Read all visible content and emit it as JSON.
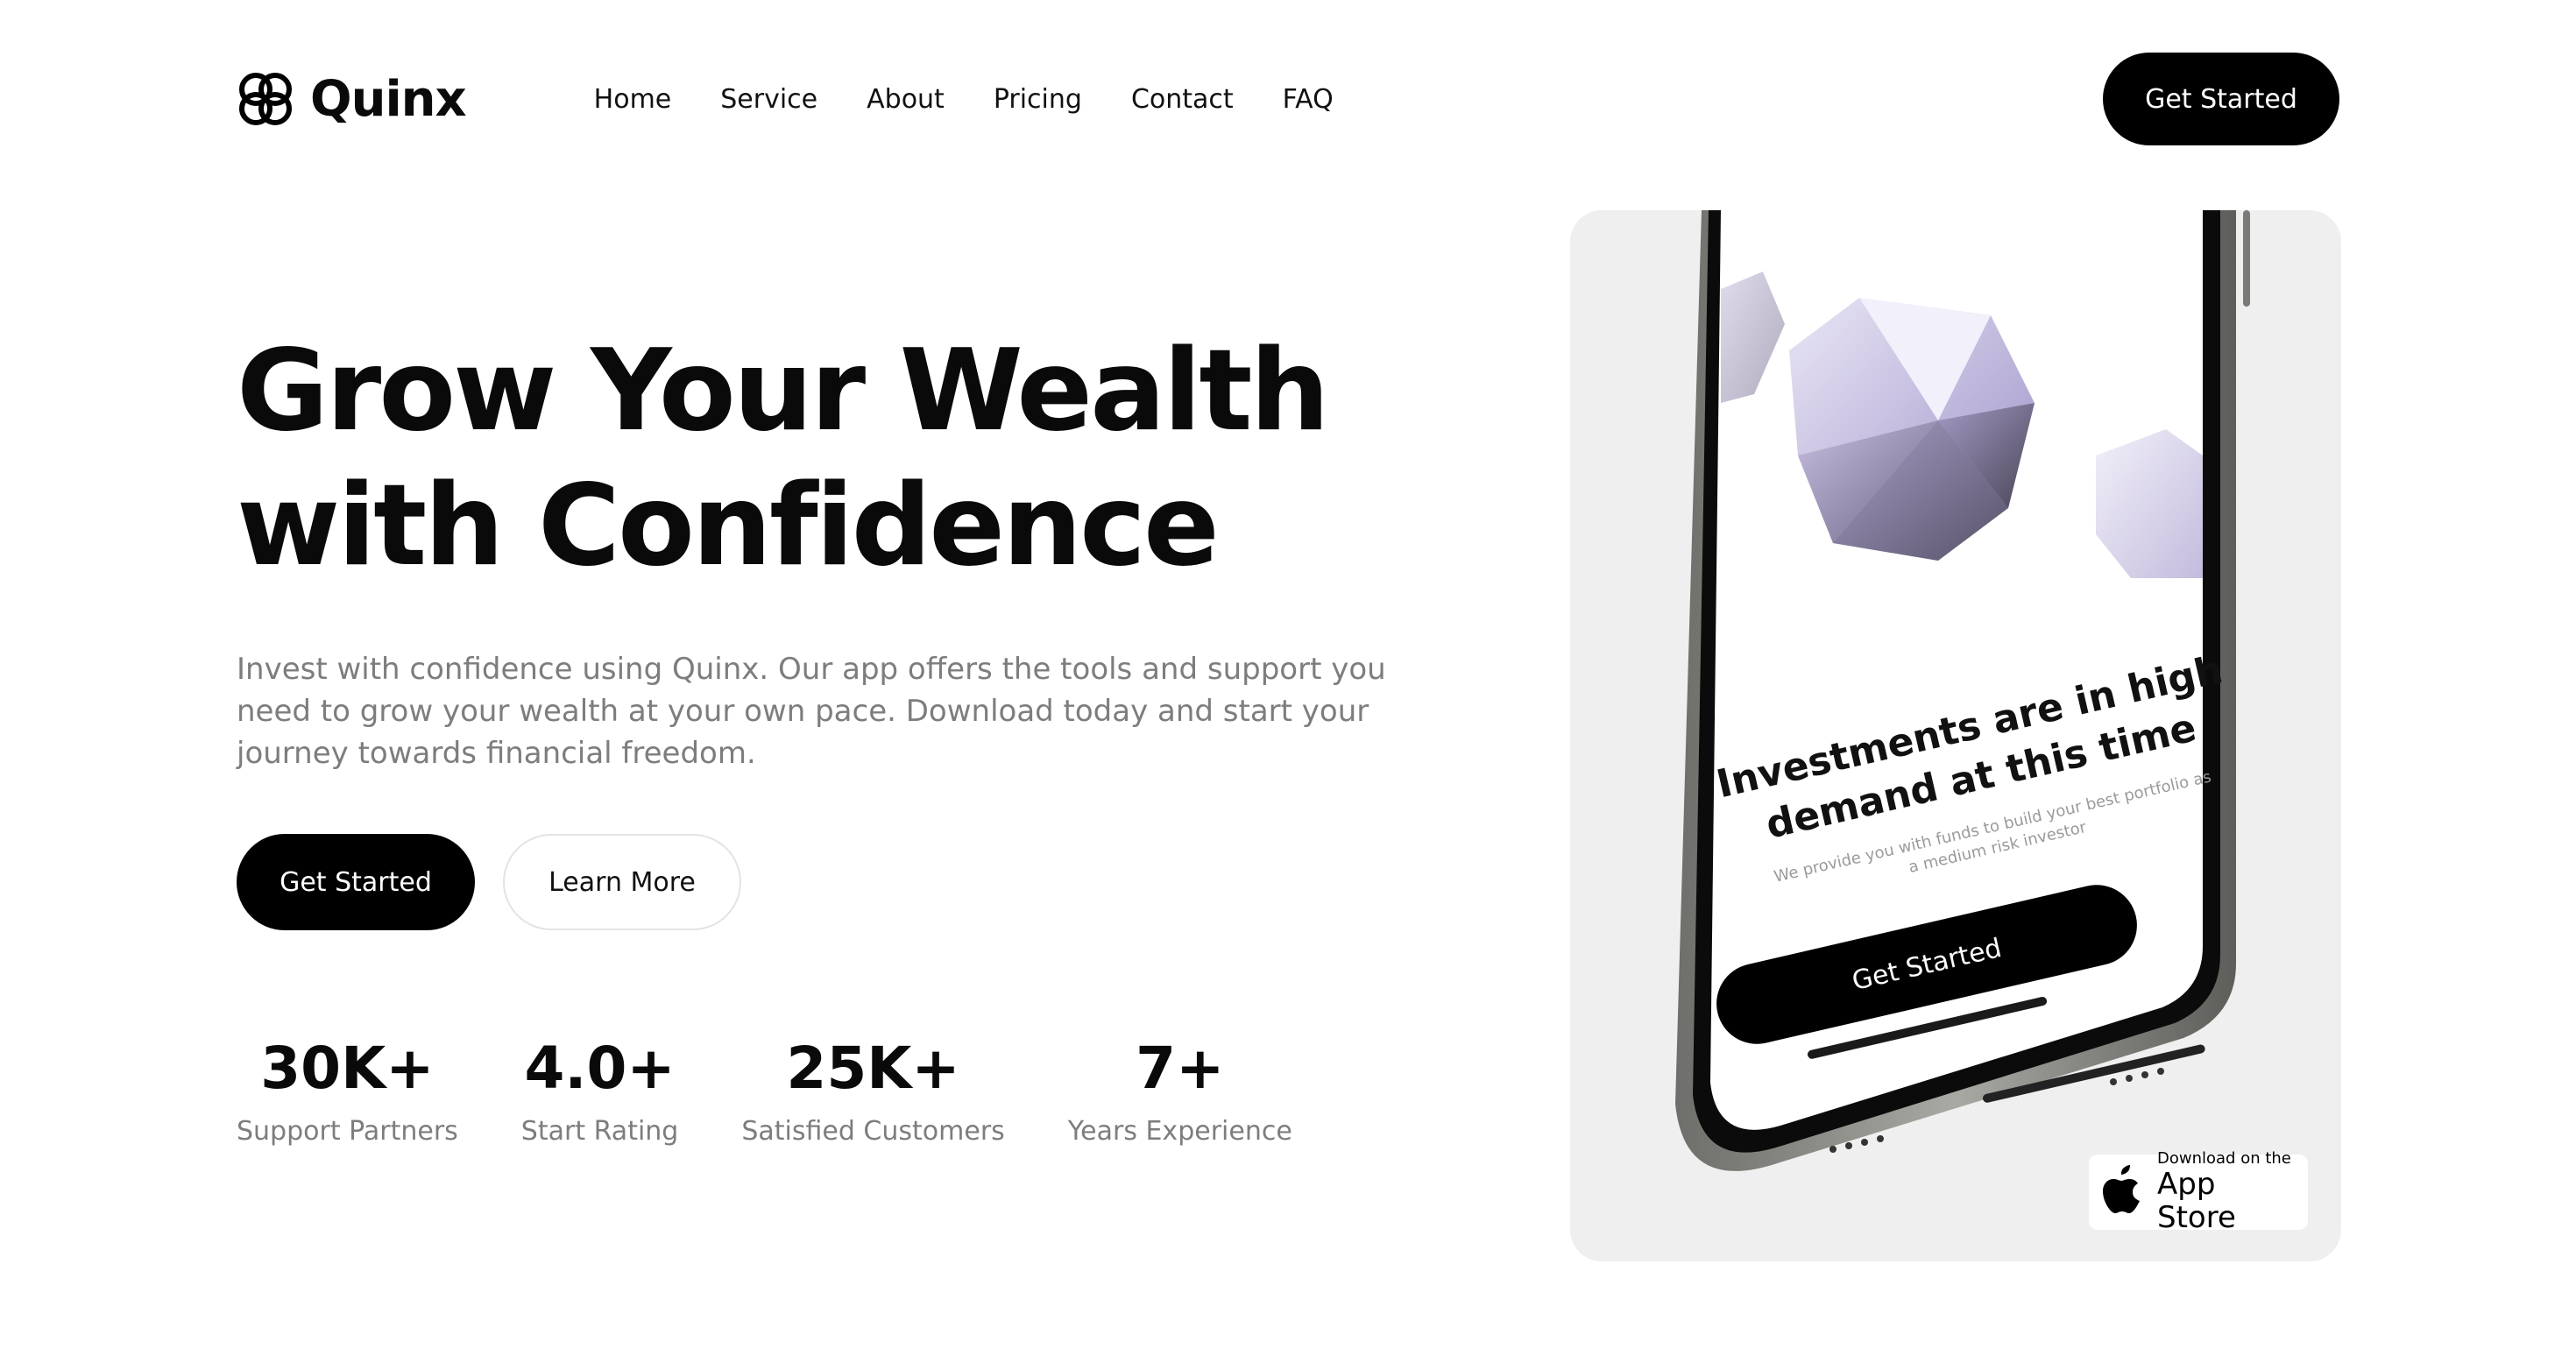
{
  "brand": {
    "name": "Quinx",
    "logo_icon": "quinx-knot-logo-icon"
  },
  "nav": {
    "links": [
      "Home",
      "Service",
      "About",
      "Pricing",
      "Contact",
      "FAQ"
    ],
    "cta_label": "Get Started"
  },
  "hero": {
    "title_line1": "Grow Your Wealth",
    "title_line2": "with Confidence",
    "description": "Invest with confidence using Quinx. Our app offers the tools and support you need to grow your wealth at your own pace. Download today and start your journey towards financial freedom.",
    "primary_label": "Get Started",
    "secondary_label": "Learn More"
  },
  "stats": [
    {
      "value": "30K+",
      "label": "Support Partners"
    },
    {
      "value": "4.0+",
      "label": "Start Rating"
    },
    {
      "value": "25K+",
      "label": "Satisfied Customers"
    },
    {
      "value": "7+",
      "label": "Years Experience"
    }
  ],
  "phone": {
    "headline_line1": "Investments are in high",
    "headline_line2": "demand at this time",
    "subtext": "We provide you with funds to build your best portfolio as a medium risk investor",
    "cta_label": "Get Started"
  },
  "appstore": {
    "small_text": "Download on the",
    "big_text": "App Store",
    "icon": "apple-icon"
  },
  "colors": {
    "primary": "#000000",
    "text_muted": "#7d7d7d",
    "card_bg": "#efefef",
    "gem_purple": "#b7a6d6"
  }
}
